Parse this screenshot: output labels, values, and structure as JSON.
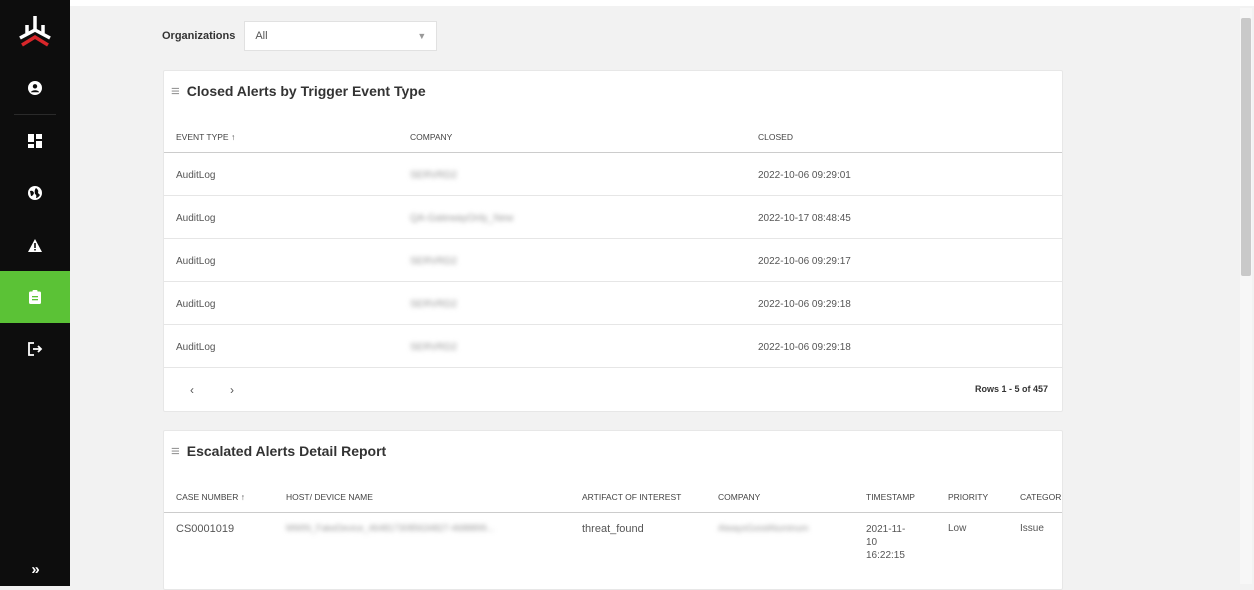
{
  "filters": {
    "organizations_label": "Organizations",
    "organizations_value": "All"
  },
  "closed_alerts": {
    "title": "Closed Alerts by Trigger Event Type",
    "columns": [
      "EVENT TYPE ↑",
      "COMPANY",
      "CLOSED"
    ],
    "rows": [
      {
        "event_type": "AuditLog",
        "company": "SERVRD2",
        "closed": "2022-10-06 09:29:01"
      },
      {
        "event_type": "AuditLog",
        "company": "QA-GatewayOnly_New",
        "closed": "2022-10-17 08:48:45"
      },
      {
        "event_type": "AuditLog",
        "company": "SERVRD2",
        "closed": "2022-10-06 09:29:17"
      },
      {
        "event_type": "AuditLog",
        "company": "SERVRD2",
        "closed": "2022-10-06 09:29:18"
      },
      {
        "event_type": "AuditLog",
        "company": "SERVRD2",
        "closed": "2022-10-06 09:29:18"
      }
    ],
    "pager": {
      "prev": "‹",
      "next": "›",
      "rows_info": "Rows 1 - 5 of 457"
    }
  },
  "escalated": {
    "title": "Escalated Alerts Detail Report",
    "columns": [
      "CASE NUMBER ↑",
      "HOST/ DEVICE NAME",
      "ARTIFACT OF INTEREST",
      "COMPANY",
      "TIMESTAMP",
      "PRIORITY",
      "CATEGOR"
    ],
    "rows": [
      {
        "case_number": "CS0001019",
        "host": "MWIN_FakeDevice_4648173085634827-4688899...",
        "artifact": "threat_found",
        "company": "AlwaysGoodAluminum",
        "timestamp": "2021-11-\n10\n16:22:15",
        "priority": "Low",
        "category": "Issue"
      }
    ]
  },
  "sidebar": {
    "items": [
      "user-circle",
      "dashboard",
      "globe",
      "alert-triangle",
      "clipboard",
      "logout"
    ],
    "active": "clipboard",
    "expand_label": "»"
  },
  "colors": {
    "sidebar_bg": "#0d0d0d",
    "active": "#5bc236",
    "logo_red": "#d9262a"
  }
}
